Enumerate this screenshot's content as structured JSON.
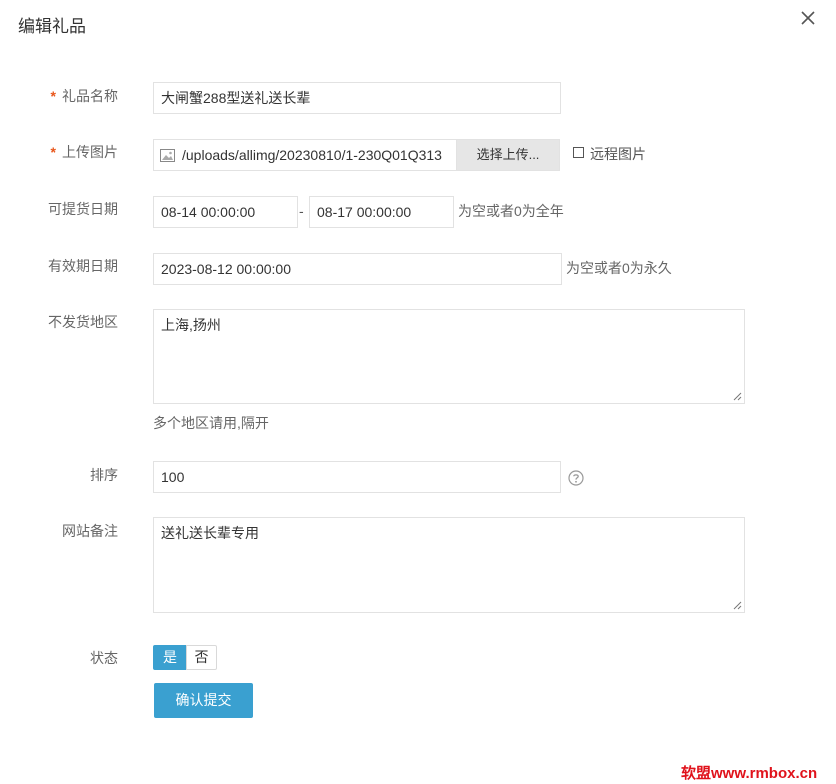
{
  "dialog": {
    "title": "编辑礼品"
  },
  "form": {
    "name": {
      "required": "*",
      "label": "礼品名称",
      "value": "大闸蟹288型送礼送长辈"
    },
    "image": {
      "required": "*",
      "label": "上传图片",
      "value": "/uploads/allimg/20230810/1-230Q01Q313",
      "button": "选择上传...",
      "remote_label": "远程图片",
      "remote_checked": false
    },
    "pickup": {
      "label": "可提货日期",
      "start": "08-14 00:00:00",
      "separator": "-",
      "end": "08-17 00:00:00",
      "hint": "为空或者0为全年"
    },
    "valid": {
      "label": "有效期日期",
      "value": "2023-08-12 00:00:00",
      "hint": "为空或者0为永久"
    },
    "no_ship": {
      "label": "不发货地区",
      "value": "上海,扬州",
      "hint": "多个地区请用,隔开"
    },
    "sort": {
      "label": "排序",
      "value": "100",
      "help_icon": "question-circle-icon"
    },
    "remark": {
      "label": "网站备注",
      "value": "送礼送长辈专用"
    },
    "status": {
      "label": "状态",
      "yes": "是",
      "no": "否",
      "selected": "是"
    },
    "submit": {
      "label": "确认提交"
    }
  },
  "watermark": {
    "text": "软盟www.rmbox.cn"
  },
  "colors": {
    "accent": "#3aa0d0",
    "required": "#e8561b",
    "watermark": "#e0121b"
  }
}
